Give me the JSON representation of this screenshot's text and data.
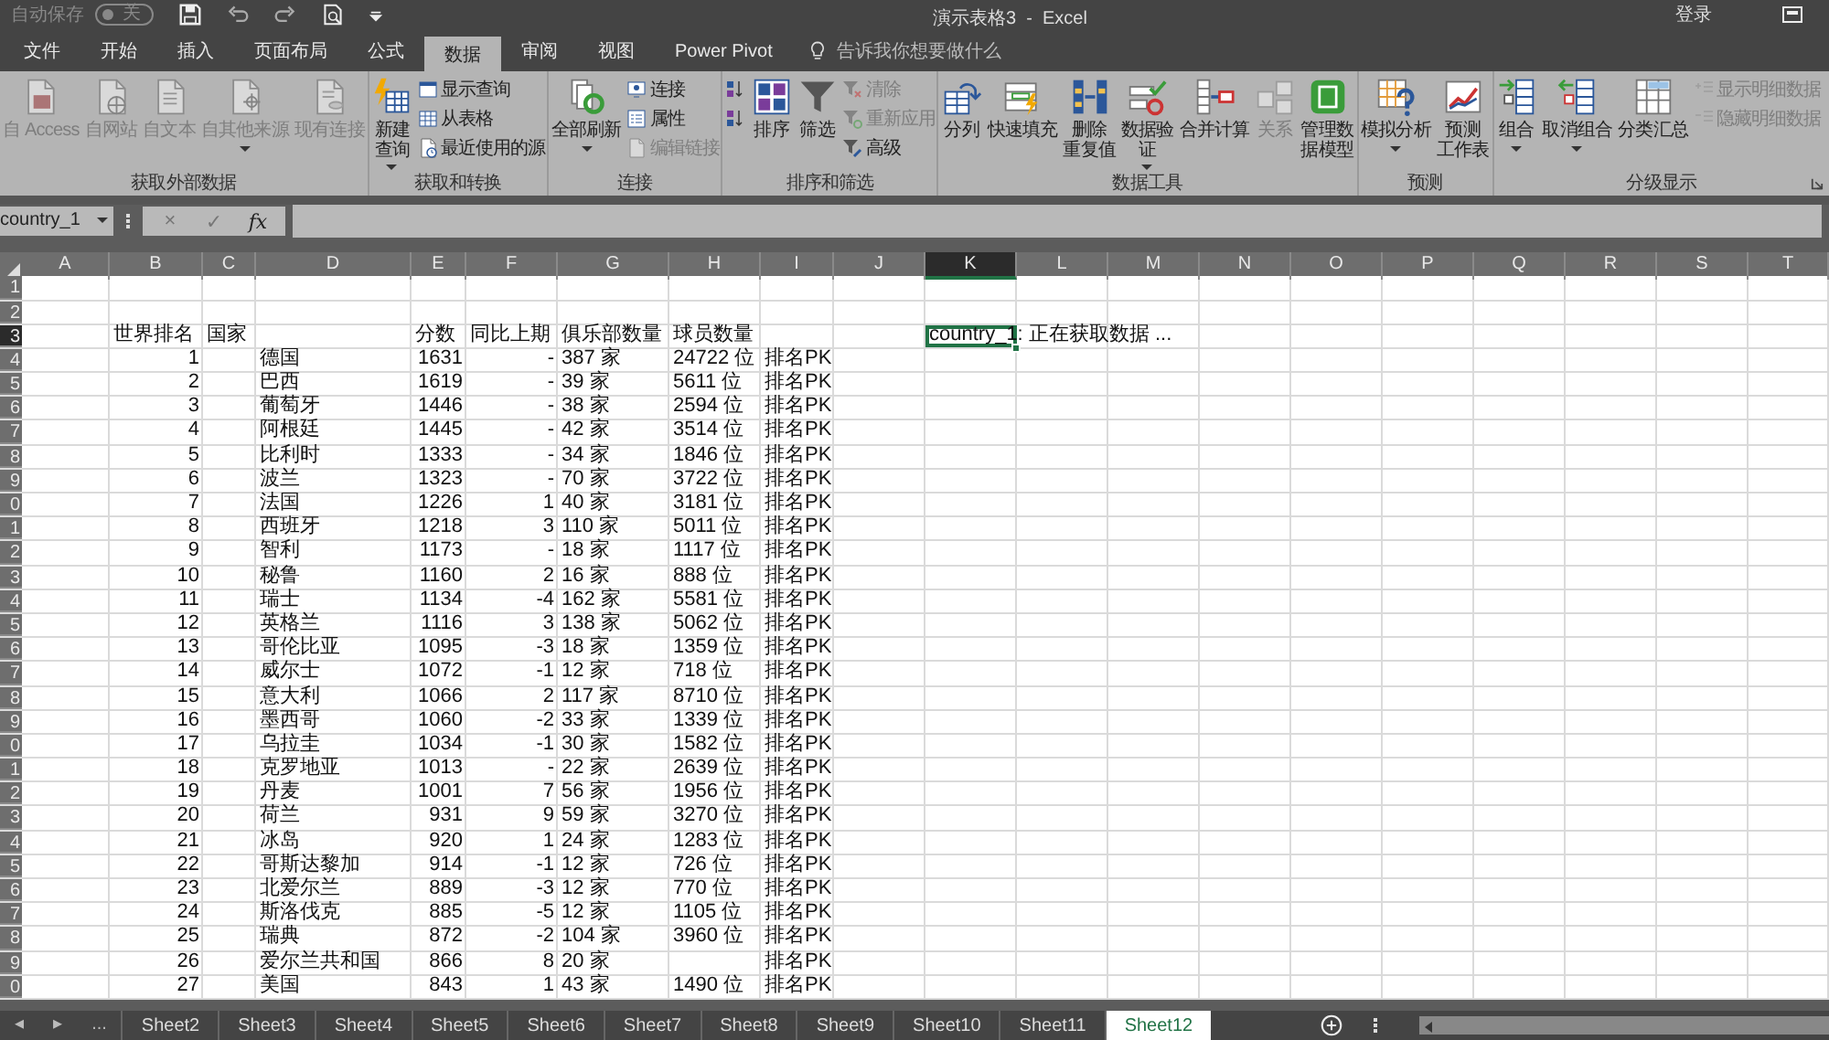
{
  "title_bar": {
    "autosave": {
      "label": "自动保存",
      "on": false,
      "state_text": "关"
    },
    "document_title": "演示表格3  -  Excel",
    "sign_in": "登录"
  },
  "tabs": [
    {
      "label": "文件",
      "selected": false
    },
    {
      "label": "开始",
      "selected": false
    },
    {
      "label": "插入",
      "selected": false
    },
    {
      "label": "页面布局",
      "selected": false
    },
    {
      "label": "公式",
      "selected": false
    },
    {
      "label": "数据",
      "selected": true
    },
    {
      "label": "审阅",
      "selected": false
    },
    {
      "label": "视图",
      "selected": false
    },
    {
      "label": "Power Pivot",
      "selected": false
    }
  ],
  "tell_me": {
    "placeholder": "告诉我你想要做什么"
  },
  "ribbon": {
    "groups": [
      {
        "label": "获取外部数据",
        "buttons": [
          {
            "kind": "large",
            "lines": [
              "自 Access"
            ],
            "disabled": true,
            "dropdown": false
          },
          {
            "kind": "large",
            "lines": [
              "自网站"
            ],
            "disabled": true,
            "dropdown": false
          },
          {
            "kind": "large",
            "lines": [
              "自文本"
            ],
            "disabled": true,
            "dropdown": false
          },
          {
            "kind": "large",
            "lines": [
              "自其他来源"
            ],
            "disabled": true,
            "dropdown": true
          },
          {
            "kind": "large",
            "lines": [
              "现有连接"
            ],
            "disabled": true,
            "dropdown": false
          }
        ]
      },
      {
        "label": "获取和转换",
        "buttons": [
          {
            "kind": "large",
            "lines": [
              "新建",
              "查询"
            ],
            "disabled": false,
            "dropdown": true
          },
          {
            "kind": "small",
            "lines": [
              "显示查询"
            ],
            "disabled": false,
            "dropdown": false
          },
          {
            "kind": "small",
            "lines": [
              "从表格"
            ],
            "disabled": false,
            "dropdown": false
          },
          {
            "kind": "small",
            "lines": [
              "最近使用的源"
            ],
            "disabled": false,
            "dropdown": false
          }
        ]
      },
      {
        "label": "连接",
        "buttons": [
          {
            "kind": "large",
            "lines": [
              "全部刷新"
            ],
            "disabled": false,
            "dropdown": true
          },
          {
            "kind": "small",
            "lines": [
              "连接"
            ],
            "disabled": false,
            "dropdown": false
          },
          {
            "kind": "small",
            "lines": [
              "属性"
            ],
            "disabled": false,
            "dropdown": false
          },
          {
            "kind": "small",
            "lines": [
              "编辑链接"
            ],
            "disabled": true,
            "dropdown": false
          }
        ]
      },
      {
        "label": "排序和筛选",
        "buttons": [
          {
            "kind": "icon",
            "disabled": false,
            "dropdown": false
          },
          {
            "kind": "icon",
            "disabled": false,
            "dropdown": false
          },
          {
            "kind": "large",
            "lines": [
              "排序"
            ],
            "disabled": false,
            "dropdown": false
          },
          {
            "kind": "large",
            "lines": [
              "筛选"
            ],
            "disabled": false,
            "dropdown": false
          },
          {
            "kind": "small",
            "lines": [
              "清除"
            ],
            "disabled": true,
            "dropdown": false
          },
          {
            "kind": "small",
            "lines": [
              "重新应用"
            ],
            "disabled": true,
            "dropdown": false
          },
          {
            "kind": "small",
            "lines": [
              "高级"
            ],
            "disabled": false,
            "dropdown": false
          }
        ]
      },
      {
        "label": "数据工具",
        "buttons": [
          {
            "kind": "large",
            "lines": [
              "分列"
            ],
            "disabled": false,
            "dropdown": false
          },
          {
            "kind": "large",
            "lines": [
              "快速填充"
            ],
            "disabled": false,
            "dropdown": false
          },
          {
            "kind": "large",
            "lines": [
              "删除",
              "重复值"
            ],
            "disabled": false,
            "dropdown": false
          },
          {
            "kind": "large",
            "lines": [
              "数据验",
              "证"
            ],
            "disabled": false,
            "dropdown": true
          },
          {
            "kind": "large",
            "lines": [
              "合并计算"
            ],
            "disabled": false,
            "dropdown": false
          },
          {
            "kind": "large",
            "lines": [
              "关系"
            ],
            "disabled": true,
            "dropdown": false
          },
          {
            "kind": "large",
            "lines": [
              "管理数",
              "据模型"
            ],
            "disabled": false,
            "dropdown": false
          }
        ]
      },
      {
        "label": "预测",
        "buttons": [
          {
            "kind": "large",
            "lines": [
              "模拟分析"
            ],
            "disabled": false,
            "dropdown": true
          },
          {
            "kind": "large",
            "lines": [
              "预测",
              "工作表"
            ],
            "disabled": false,
            "dropdown": false
          }
        ]
      },
      {
        "label": "分级显示",
        "buttons": [
          {
            "kind": "large",
            "lines": [
              "组合"
            ],
            "disabled": false,
            "dropdown": true
          },
          {
            "kind": "large",
            "lines": [
              "取消组合"
            ],
            "disabled": false,
            "dropdown": true
          },
          {
            "kind": "large",
            "lines": [
              "分类汇总"
            ],
            "disabled": false,
            "dropdown": false
          },
          {
            "kind": "small",
            "lines": [
              "显示明细数据"
            ],
            "disabled": true,
            "dropdown": false
          },
          {
            "kind": "small",
            "lines": [
              "隐藏明细数据"
            ],
            "disabled": true,
            "dropdown": false
          }
        ]
      }
    ]
  },
  "formula_bar": {
    "name_box": "country_1",
    "buttons": [
      "×",
      "✓",
      "fx"
    ]
  },
  "sheet": {
    "columns": [
      {
        "label": "A",
        "selected": false
      },
      {
        "label": "B",
        "selected": false
      },
      {
        "label": "C",
        "selected": false
      },
      {
        "label": "D",
        "selected": false
      },
      {
        "label": "E",
        "selected": false
      },
      {
        "label": "F",
        "selected": false
      },
      {
        "label": "G",
        "selected": false
      },
      {
        "label": "H",
        "selected": false
      },
      {
        "label": "I",
        "selected": false
      },
      {
        "label": "J",
        "selected": false
      },
      {
        "label": "K",
        "selected": true
      },
      {
        "label": "L",
        "selected": false
      },
      {
        "label": "M",
        "selected": false
      },
      {
        "label": "N",
        "selected": false
      },
      {
        "label": "O",
        "selected": false
      },
      {
        "label": "P",
        "selected": false
      },
      {
        "label": "Q",
        "selected": false
      },
      {
        "label": "R",
        "selected": false
      },
      {
        "label": "S",
        "selected": false
      },
      {
        "label": "T",
        "selected": false
      }
    ],
    "rows": [
      {
        "header": "1",
        "selected": false,
        "kind": "data"
      },
      {
        "header": "2",
        "selected": false,
        "kind": "data"
      },
      {
        "header": "3",
        "selected": true,
        "kind": "heading",
        "cells": {
          "B": "世界排名",
          "C": "国家",
          "E": "分数",
          "F": "同比上期",
          "G": "俱乐部数量",
          "H": "球员数量",
          "K": "country_1: 正在获取数据 ..."
        }
      },
      {
        "header": "4",
        "selected": false,
        "kind": "data",
        "cells": {
          "B": "1",
          "D": "德国",
          "E": "1631",
          "F": "-",
          "G": "387 家",
          "H": "24722 位",
          "I": "排名PK"
        }
      },
      {
        "header": "5",
        "selected": false,
        "kind": "data",
        "cells": {
          "B": "2",
          "D": "巴西",
          "E": "1619",
          "F": "-",
          "G": "39 家",
          "H": "5611 位",
          "I": "排名PK"
        }
      },
      {
        "header": "6",
        "selected": false,
        "kind": "data",
        "cells": {
          "B": "3",
          "D": "葡萄牙",
          "E": "1446",
          "F": "-",
          "G": "38 家",
          "H": "2594 位",
          "I": "排名PK"
        }
      },
      {
        "header": "7",
        "selected": false,
        "kind": "data",
        "cells": {
          "B": "4",
          "D": "阿根廷",
          "E": "1445",
          "F": "-",
          "G": "42 家",
          "H": "3514 位",
          "I": "排名PK"
        }
      },
      {
        "header": "8",
        "selected": false,
        "kind": "data",
        "cells": {
          "B": "5",
          "D": "比利时",
          "E": "1333",
          "F": "-",
          "G": "34 家",
          "H": "1846 位",
          "I": "排名PK"
        }
      },
      {
        "header": "9",
        "selected": false,
        "kind": "data",
        "cells": {
          "B": "6",
          "D": "波兰",
          "E": "1323",
          "F": "-",
          "G": "70 家",
          "H": "3722 位",
          "I": "排名PK"
        }
      },
      {
        "header": "0",
        "selected": false,
        "kind": "data",
        "cells": {
          "B": "7",
          "D": "法国",
          "E": "1226",
          "F": "1",
          "G": "40 家",
          "H": "3181 位",
          "I": "排名PK"
        }
      },
      {
        "header": "1",
        "selected": false,
        "kind": "data",
        "cells": {
          "B": "8",
          "D": "西班牙",
          "E": "1218",
          "F": "3",
          "G": "110 家",
          "H": "5011 位",
          "I": "排名PK"
        }
      },
      {
        "header": "2",
        "selected": false,
        "kind": "data",
        "cells": {
          "B": "9",
          "D": "智利",
          "E": "1173",
          "F": "-",
          "G": "18 家",
          "H": "1117 位",
          "I": "排名PK"
        }
      },
      {
        "header": "3",
        "selected": false,
        "kind": "data",
        "cells": {
          "B": "10",
          "D": "秘鲁",
          "E": "1160",
          "F": "2",
          "G": "16 家",
          "H": "888 位",
          "I": "排名PK"
        }
      },
      {
        "header": "4",
        "selected": false,
        "kind": "data",
        "cells": {
          "B": "11",
          "D": "瑞士",
          "E": "1134",
          "F": "-4",
          "G": "162 家",
          "H": "5581 位",
          "I": "排名PK"
        }
      },
      {
        "header": "5",
        "selected": false,
        "kind": "data",
        "cells": {
          "B": "12",
          "D": "英格兰",
          "E": "1116",
          "F": "3",
          "G": "138 家",
          "H": "5062 位",
          "I": "排名PK"
        }
      },
      {
        "header": "6",
        "selected": false,
        "kind": "data",
        "cells": {
          "B": "13",
          "D": "哥伦比亚",
          "E": "1095",
          "F": "-3",
          "G": "18 家",
          "H": "1359 位",
          "I": "排名PK"
        }
      },
      {
        "header": "7",
        "selected": false,
        "kind": "data",
        "cells": {
          "B": "14",
          "D": "威尔士",
          "E": "1072",
          "F": "-1",
          "G": "12 家",
          "H": "718 位",
          "I": "排名PK"
        }
      },
      {
        "header": "8",
        "selected": false,
        "kind": "data",
        "cells": {
          "B": "15",
          "D": "意大利",
          "E": "1066",
          "F": "2",
          "G": "117 家",
          "H": "8710 位",
          "I": "排名PK"
        }
      },
      {
        "header": "9",
        "selected": false,
        "kind": "data",
        "cells": {
          "B": "16",
          "D": "墨西哥",
          "E": "1060",
          "F": "-2",
          "G": "33 家",
          "H": "1339 位",
          "I": "排名PK"
        }
      },
      {
        "header": "0",
        "selected": false,
        "kind": "data",
        "cells": {
          "B": "17",
          "D": "乌拉圭",
          "E": "1034",
          "F": "-1",
          "G": "30 家",
          "H": "1582 位",
          "I": "排名PK"
        }
      },
      {
        "header": "1",
        "selected": false,
        "kind": "data",
        "cells": {
          "B": "18",
          "D": "克罗地亚",
          "E": "1013",
          "F": "-",
          "G": "22 家",
          "H": "2639 位",
          "I": "排名PK"
        }
      },
      {
        "header": "2",
        "selected": false,
        "kind": "data",
        "cells": {
          "B": "19",
          "D": "丹麦",
          "E": "1001",
          "F": "7",
          "G": "56 家",
          "H": "1956 位",
          "I": "排名PK"
        }
      },
      {
        "header": "3",
        "selected": false,
        "kind": "data",
        "cells": {
          "B": "20",
          "D": "荷兰",
          "E": "931",
          "F": "9",
          "G": "59 家",
          "H": "3270 位",
          "I": "排名PK"
        }
      },
      {
        "header": "4",
        "selected": false,
        "kind": "data",
        "cells": {
          "B": "21",
          "D": "冰岛",
          "E": "920",
          "F": "1",
          "G": "24 家",
          "H": "1283 位",
          "I": "排名PK"
        }
      },
      {
        "header": "5",
        "selected": false,
        "kind": "data",
        "cells": {
          "B": "22",
          "D": "哥斯达黎加",
          "E": "914",
          "F": "-1",
          "G": "12 家",
          "H": "726 位",
          "I": "排名PK"
        }
      },
      {
        "header": "6",
        "selected": false,
        "kind": "data",
        "cells": {
          "B": "23",
          "D": "北爱尔兰",
          "E": "889",
          "F": "-3",
          "G": "12 家",
          "H": "770 位",
          "I": "排名PK"
        }
      },
      {
        "header": "7",
        "selected": false,
        "kind": "data",
        "cells": {
          "B": "24",
          "D": "斯洛伐克",
          "E": "885",
          "F": "-5",
          "G": "12 家",
          "H": "1105 位",
          "I": "排名PK"
        }
      },
      {
        "header": "8",
        "selected": false,
        "kind": "data",
        "cells": {
          "B": "25",
          "D": "瑞典",
          "E": "872",
          "F": "-2",
          "G": "104 家",
          "H": "3960 位",
          "I": "排名PK"
        }
      },
      {
        "header": "9",
        "selected": false,
        "kind": "data",
        "cells": {
          "B": "26",
          "D": "爱尔兰共和国",
          "E": "866",
          "F": "8",
          "G": "20 家",
          "I": "排名PK"
        }
      },
      {
        "header": "0",
        "selected": false,
        "kind": "data",
        "cells": {
          "B": "27",
          "D": "美国",
          "E": "843",
          "F": "1",
          "G": "43 家",
          "H": "1490 位",
          "I": "排名PK"
        }
      }
    ]
  },
  "sheet_tabs": {
    "nav": [
      "◂",
      "▸",
      "..."
    ],
    "tabs": [
      {
        "label": "Sheet2",
        "selected": false
      },
      {
        "label": "Sheet3",
        "selected": false
      },
      {
        "label": "Sheet4",
        "selected": false
      },
      {
        "label": "Sheet5",
        "selected": false
      },
      {
        "label": "Sheet6",
        "selected": false
      },
      {
        "label": "Sheet7",
        "selected": false
      },
      {
        "label": "Sheet8",
        "selected": false
      },
      {
        "label": "Sheet9",
        "selected": false
      },
      {
        "label": "Sheet10",
        "selected": false
      },
      {
        "label": "Sheet11",
        "selected": false
      },
      {
        "label": "Sheet12",
        "selected": true
      }
    ]
  }
}
